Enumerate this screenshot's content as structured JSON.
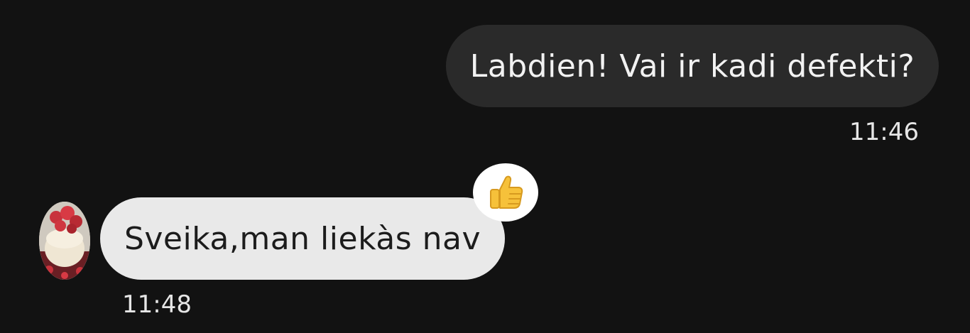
{
  "messages": {
    "outgoing": {
      "text": "Labdien! Vai ir kadi defekti?",
      "time": "11:46"
    },
    "incoming": {
      "text": "Sveika,man liekàs nav",
      "time": "11:48",
      "reaction_icon": "thumbs-up-icon"
    }
  },
  "colors": {
    "background": "#121212",
    "outgoing_bubble": "#2a2a2a",
    "incoming_bubble": "#e9e9e9",
    "reaction_badge": "#ffffff"
  }
}
